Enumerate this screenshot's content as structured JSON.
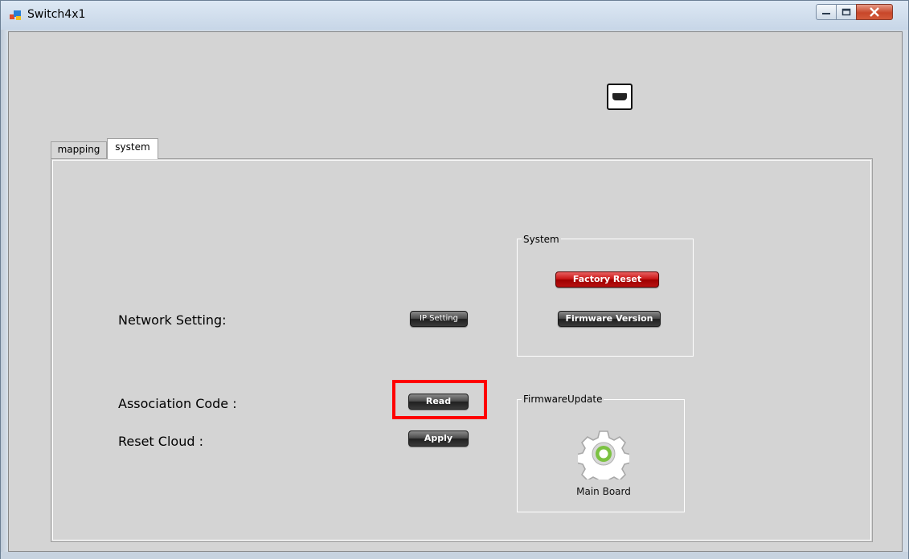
{
  "window": {
    "title": "Switch4x1",
    "controls": {
      "minimize_icon": "minimize-icon",
      "maximize_icon": "maximize-icon",
      "close_icon": "close-icon"
    }
  },
  "tabs": [
    {
      "label": "mapping",
      "selected": false
    },
    {
      "label": "system",
      "selected": true
    }
  ],
  "system_tab": {
    "network_setting_label": "Network Setting:",
    "ip_setting_button": "IP Setting",
    "association_code_label": "Association Code :",
    "read_button": "Read",
    "reset_cloud_label": "Reset Cloud :",
    "apply_button": "Apply",
    "system_group": {
      "title": "System",
      "factory_reset_button": "Factory Reset",
      "firmware_version_button": "Firmware Version"
    },
    "firmware_update_group": {
      "title": "FirmwareUpdate",
      "main_board_label": "Main Board",
      "main_board_icon": "gear-icon"
    }
  },
  "colors": {
    "highlight": "#ff0000",
    "factory_reset": "#c81414",
    "gear_accent": "#7cc242"
  }
}
